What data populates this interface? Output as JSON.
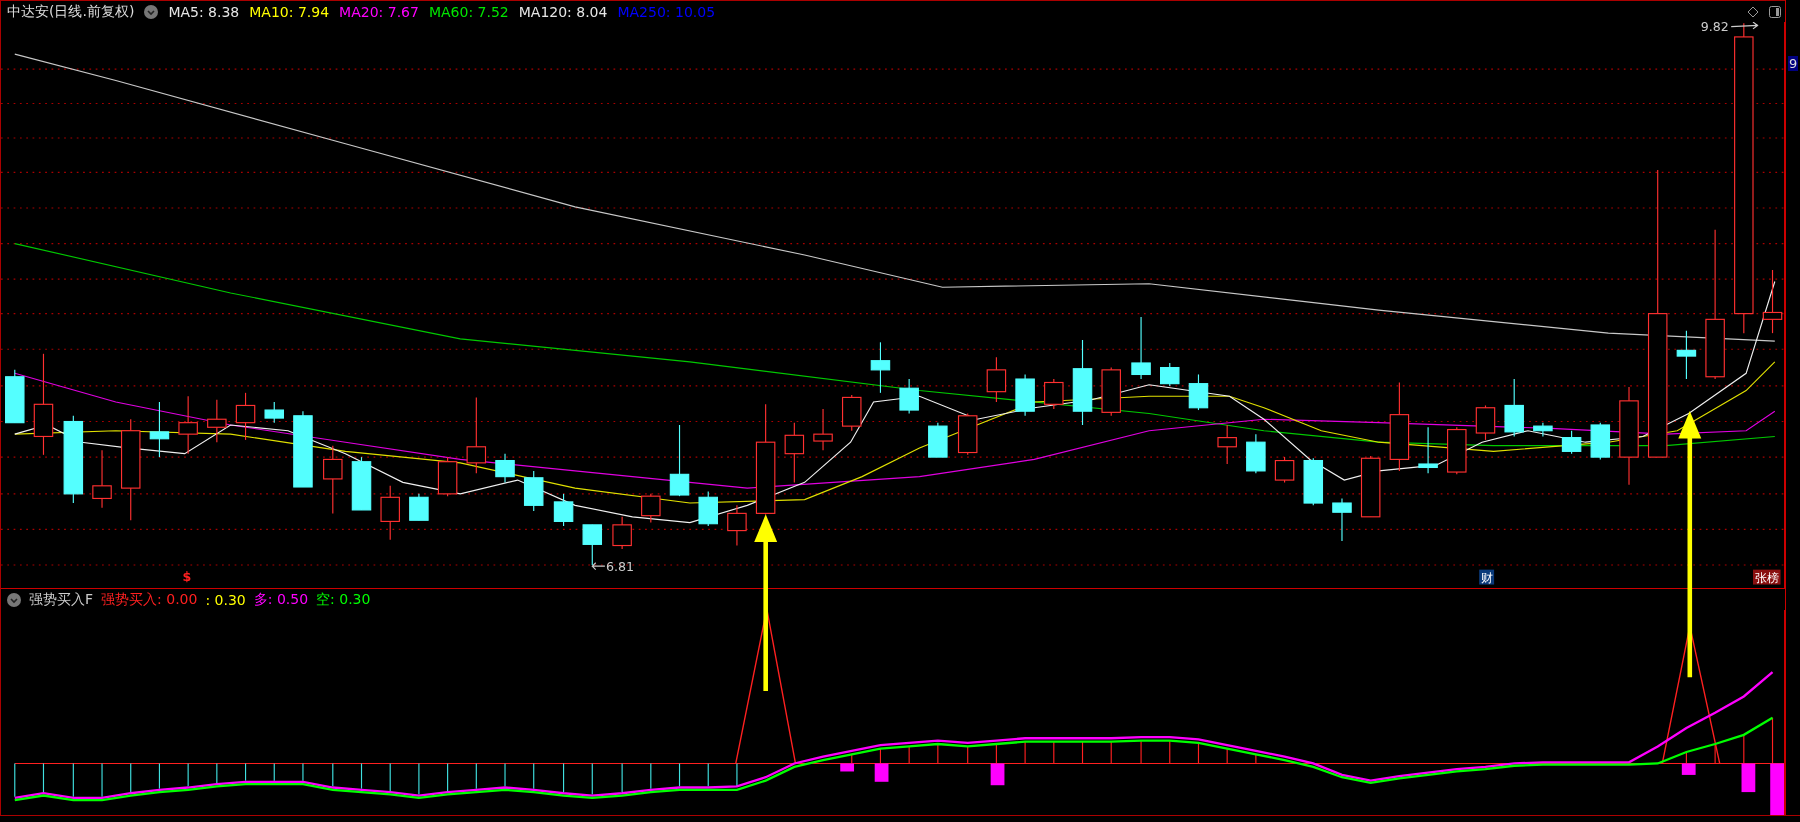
{
  "title": "中达安(日线.前复权)",
  "ma": [
    {
      "label": "MA5: 8.38",
      "color": "#e6e6e6"
    },
    {
      "label": "MA10: 7.94",
      "color": "#ffff00"
    },
    {
      "label": "MA20: 7.67",
      "color": "#ff00ff"
    },
    {
      "label": "MA60: 7.52",
      "color": "#00e600"
    },
    {
      "label": "MA120: 8.04",
      "color": "#e6e6e6"
    },
    {
      "label": "MA250: 10.05",
      "color": "#0000ff"
    }
  ],
  "price_labels": {
    "high": "9.82",
    "low": "6.81",
    "axis": "9"
  },
  "markers": [
    {
      "text": "$",
      "kind": "symbol"
    },
    {
      "text": "财",
      "kind": "badge",
      "color": "#0a3a7a"
    },
    {
      "text": "张榜",
      "kind": "badge",
      "color": "#8a1010"
    }
  ],
  "indicator": {
    "name": "强势买入F",
    "values": [
      {
        "label": "强势买入: 0.00",
        "color": "#ff2020"
      },
      {
        "label": ": 0.30",
        "color": "#ffff00"
      },
      {
        "label": "多: 0.50",
        "color": "#ff00ff"
      },
      {
        "label": "空: 0.30",
        "color": "#00ff00"
      }
    ]
  }
}
